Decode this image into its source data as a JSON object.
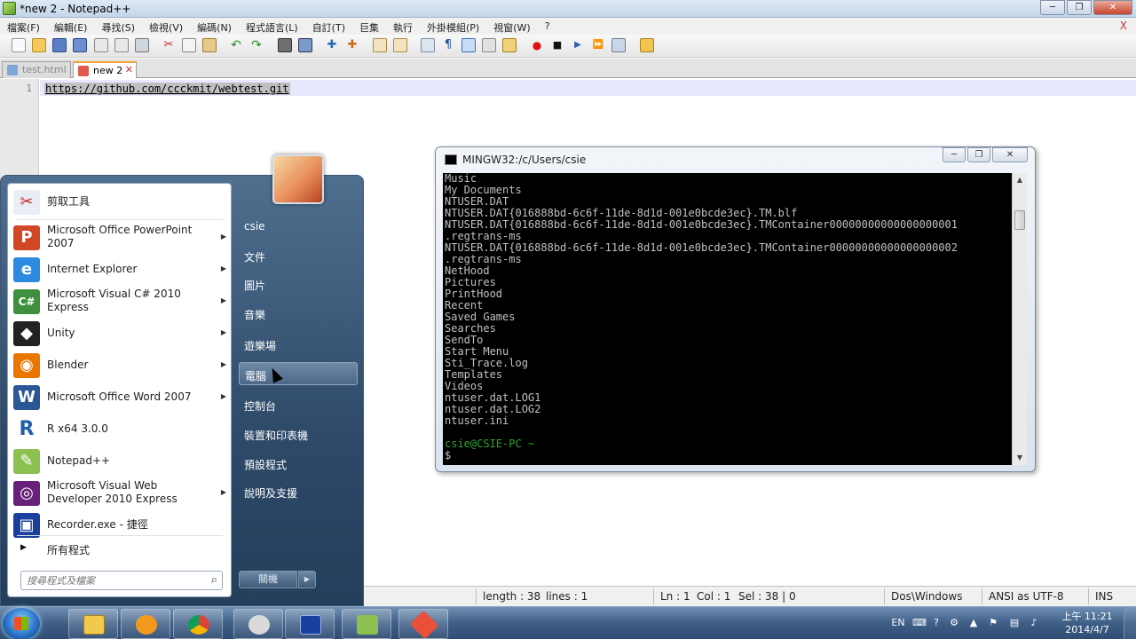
{
  "notepad": {
    "title": "*new 2 - Notepad++",
    "menu": [
      "檔案(F)",
      "編輯(E)",
      "尋找(S)",
      "檢視(V)",
      "編碼(N)",
      "程式語言(L)",
      "自訂(T)",
      "巨集",
      "執行",
      "外掛模組(P)",
      "視窗(W)",
      "?"
    ],
    "menu_close": "X",
    "tabs": [
      {
        "label": "test.html",
        "active": false
      },
      {
        "label": "new  2",
        "active": true
      }
    ],
    "editor": {
      "line_number": "1",
      "line_text": "https://github.com/ccckmit/webtest.git"
    },
    "status": {
      "length": "length : 38",
      "lines": "lines : 1",
      "ln": "Ln : 1",
      "col": "Col : 1",
      "sel": "Sel : 38 | 0",
      "eol": "Dos\\Windows",
      "encoding": "ANSI as UTF-8",
      "mode": "INS"
    }
  },
  "console": {
    "title": "MINGW32:/c/Users/csie",
    "lines": [
      "Music",
      "My Documents",
      "NTUSER.DAT",
      "NTUSER.DAT{016888bd-6c6f-11de-8d1d-001e0bcde3ec}.TM.blf",
      "NTUSER.DAT{016888bd-6c6f-11de-8d1d-001e0bcde3ec}.TMContainer00000000000000000001",
      ".regtrans-ms",
      "NTUSER.DAT{016888bd-6c6f-11de-8d1d-001e0bcde3ec}.TMContainer00000000000000000002",
      ".regtrans-ms",
      "NetHood",
      "Pictures",
      "PrintHood",
      "Recent",
      "Saved Games",
      "Searches",
      "SendTo",
      "Start Menu",
      "Sti_Trace.log",
      "Templates",
      "Videos",
      "ntuser.dat.LOG1",
      "ntuser.dat.LOG2",
      "ntuser.ini",
      "",
      "csie@CSIE-PC ~",
      "$"
    ]
  },
  "startmenu": {
    "programs": [
      {
        "label": "剪取工具",
        "icon": "scissors-icon",
        "arrow": false
      },
      {
        "label": "Microsoft Office PowerPoint 2007",
        "icon": "powerpoint-icon",
        "arrow": true
      },
      {
        "label": "Internet Explorer",
        "icon": "ie-icon",
        "arrow": true
      },
      {
        "label": "Microsoft Visual C# 2010 Express",
        "icon": "csharp-icon",
        "arrow": true
      },
      {
        "label": "Unity",
        "icon": "unity-icon",
        "arrow": true
      },
      {
        "label": "Blender",
        "icon": "blender-icon",
        "arrow": true
      },
      {
        "label": "Microsoft Office Word 2007",
        "icon": "word-icon",
        "arrow": true
      },
      {
        "label": "R x64 3.0.0",
        "icon": "r-icon",
        "arrow": false
      },
      {
        "label": "Notepad++",
        "icon": "notepadpp-icon",
        "arrow": false
      },
      {
        "label": "Microsoft Visual Web Developer 2010 Express",
        "icon": "vwd-icon",
        "arrow": true
      },
      {
        "label": "Recorder.exe - 捷徑",
        "icon": "recorder-icon",
        "arrow": false
      }
    ],
    "all_programs": "所有程式",
    "search_placeholder": "搜尋程式及檔案",
    "right_items": [
      "csie",
      "文件",
      "圖片",
      "音樂",
      "遊樂場",
      "電腦",
      "控制台",
      "裝置和印表機",
      "預設程式",
      "說明及支援"
    ],
    "shutdown": "關機"
  },
  "taskbar": {
    "lang": "EN",
    "time": "上午 11:21",
    "date": "2014/4/7"
  },
  "colors": {
    "console_bg": "#000000",
    "console_text": "#c0c0c0",
    "prompt_green": "#2fa52f",
    "editor_line_bg": "#e8e8ff"
  }
}
